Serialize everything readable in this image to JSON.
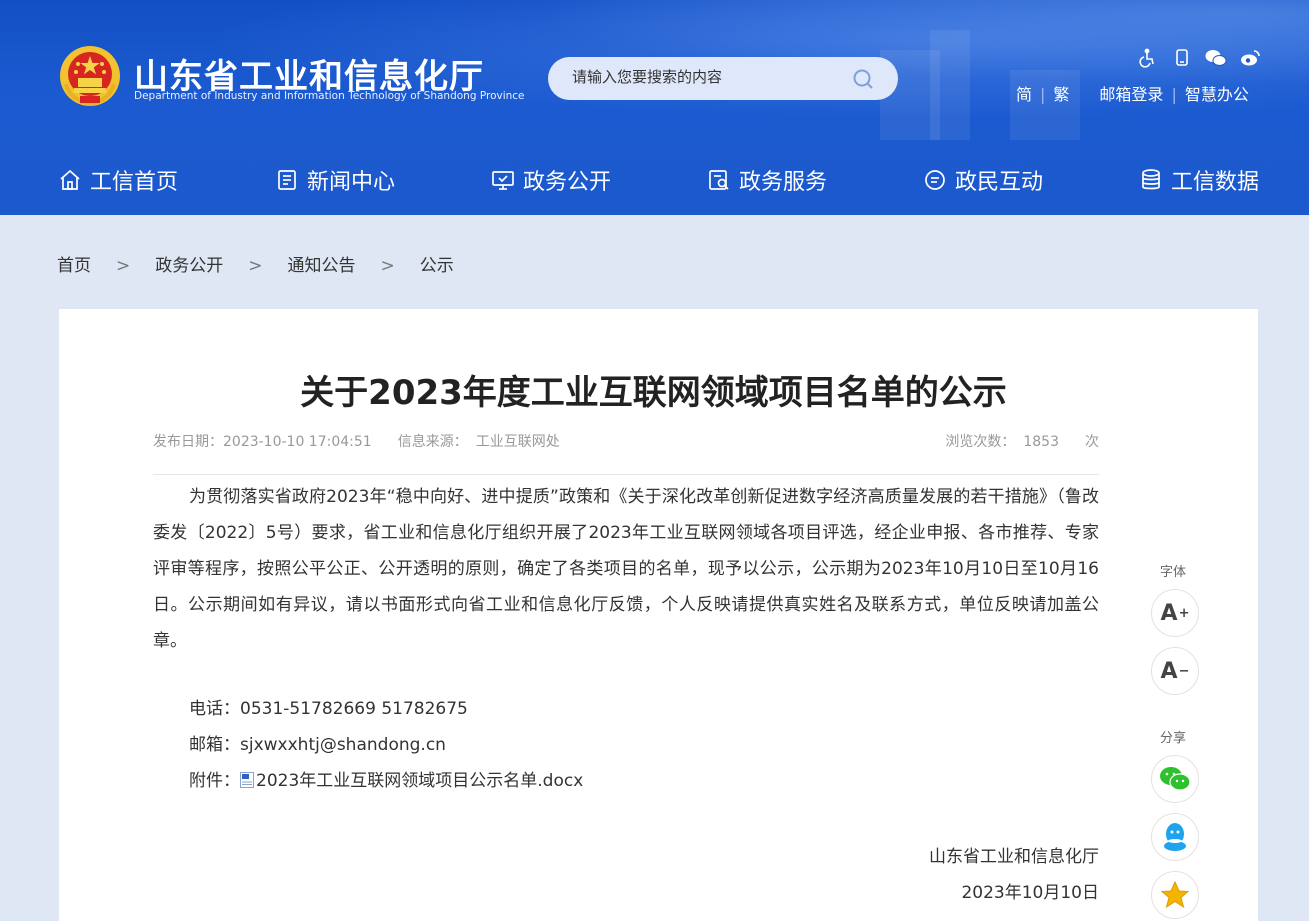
{
  "header": {
    "title": "山东省工业和信息化厅",
    "subtitle": "Department of Industry and Information Technology of Shandong Province",
    "search_placeholder": "请输入您要搜索的内容",
    "top_icons": [
      "accessibility-icon",
      "mobile-icon",
      "wechat-icon",
      "weibo-icon"
    ],
    "links": {
      "simplified": "简",
      "traditional": "繁",
      "mail_login": "邮箱登录",
      "smart_office": "智慧办公",
      "sep": "|"
    }
  },
  "nav": {
    "items": [
      {
        "label": "工信首页",
        "icon": "home-icon"
      },
      {
        "label": "新闻中心",
        "icon": "news-icon"
      },
      {
        "label": "政务公开",
        "icon": "monitor-icon"
      },
      {
        "label": "政务服务",
        "icon": "service-icon"
      },
      {
        "label": "政民互动",
        "icon": "chat-icon"
      },
      {
        "label": "工信数据",
        "icon": "database-icon"
      }
    ]
  },
  "breadcrumb": {
    "items": [
      "首页",
      "政务公开",
      "通知公告",
      "公示"
    ],
    "sep": ">"
  },
  "article": {
    "title": "关于2023年度工业互联网领域项目名单的公示",
    "meta": {
      "publish_label": "发布日期：",
      "publish_date": "2023-10-10 17:04:51",
      "source_label": "信息来源：",
      "source": "工业互联网处",
      "views_label": "浏览次数：",
      "views": "1853",
      "views_unit": "次"
    },
    "body": "为贯彻落实省政府2023年“稳中向好、进中提质”政策和《关于深化改革创新促进数字经济高质量发展的若干措施》（鲁改委发〔2022〕5号）要求，省工业和信息化厅组织开展了2023年工业互联网领域各项目评选，经企业申报、各市推荐、专家评审等程序，按照公平公正、公开透明的原则，确定了各类项目的名单，现予以公示，公示期为2023年10月10日至10月16日。公示期间如有异议，请以书面形式向省工业和信息化厅反馈，个人反映请提供真实姓名及联系方式，单位反映请加盖公章。",
    "contact": {
      "phone_label": "电话：",
      "phone": "0531-51782669 51782675",
      "email_label": "邮箱：",
      "email": "sjxwxxhtj@shandong.cn",
      "attachment_label": "附件：",
      "attachment": "2023年工业互联网领域项目公示名单.docx"
    },
    "signature": {
      "org": "山东省工业和信息化厅",
      "date": "2023年10月10日"
    }
  },
  "side_tools": {
    "font_label": "字体",
    "font_increase": "A",
    "font_increase_sign": "+",
    "font_decrease": "A",
    "font_decrease_sign": "−",
    "share_label": "分享",
    "share_items": [
      "wechat-share-icon",
      "qq-share-icon",
      "favorite-star-icon"
    ]
  },
  "colors": {
    "header_blue": "#1b58cc",
    "page_bg": "#dfe7f4",
    "share_green": "#2ec12e",
    "share_blue": "#1ea3ef",
    "star_gold": "#f4b400"
  }
}
